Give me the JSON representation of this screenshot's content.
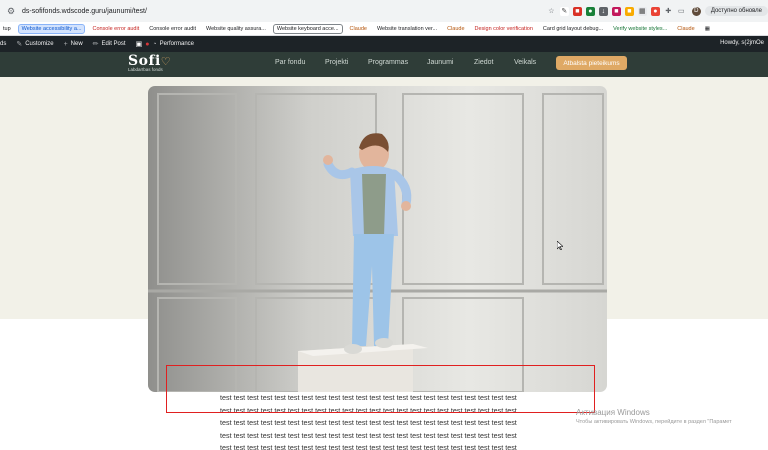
{
  "browser": {
    "url": "ds-sofifonds.wdscode.guru/jaunumi/test/",
    "profile_initial": "D",
    "update_label": "Доступно обновле"
  },
  "bookmarks": [
    {
      "label": "tup",
      "style": "plain"
    },
    {
      "label": "Website accessibility a...",
      "style": "blue"
    },
    {
      "label": "Console error audit",
      "style": "red"
    },
    {
      "label": "Console error audit",
      "style": "plain"
    },
    {
      "label": "Website quality assura...",
      "style": "plain"
    },
    {
      "label": "Website keyboard acce...",
      "style": "boxed"
    },
    {
      "label": "Claude",
      "style": "orange"
    },
    {
      "label": "Website translation ver...",
      "style": "plain"
    },
    {
      "label": "Claude",
      "style": "orange"
    },
    {
      "label": "Design color verification",
      "style": "red"
    },
    {
      "label": "Card grid layout debug...",
      "style": "plain"
    },
    {
      "label": "Verify website styles...",
      "style": "green"
    },
    {
      "label": "Claude",
      "style": "orange"
    }
  ],
  "wp_admin": {
    "items": [
      "ds",
      "Customize",
      "New",
      "Edit Post",
      "Performance"
    ],
    "howdy": "Howdy, s(2jmOe"
  },
  "site": {
    "logo": "Sofi",
    "logo_sub": "Labdarības fonds",
    "nav": [
      "Par fondu",
      "Projekti",
      "Programmas",
      "Jaunumi",
      "Ziedot",
      "Veikals"
    ],
    "cta": "Atbalsta pieteikums"
  },
  "content": {
    "lines": [
      "test test test test test test test test test test test test test test test test test test test test test test",
      "test test test test test test test test test test test test test test test test test test test test test test",
      "test test test test test test test test test test test test test test test test test test test test test test",
      "test test test test test test test test test test test test test test test test test test test test test test",
      "test test test test test test test test test test test test test test test test test test test test test test"
    ]
  },
  "watermark": {
    "line1": "Активация Windows",
    "line2": "Чтобы активировать Windows, перейдите в раздел \"Парамет"
  }
}
